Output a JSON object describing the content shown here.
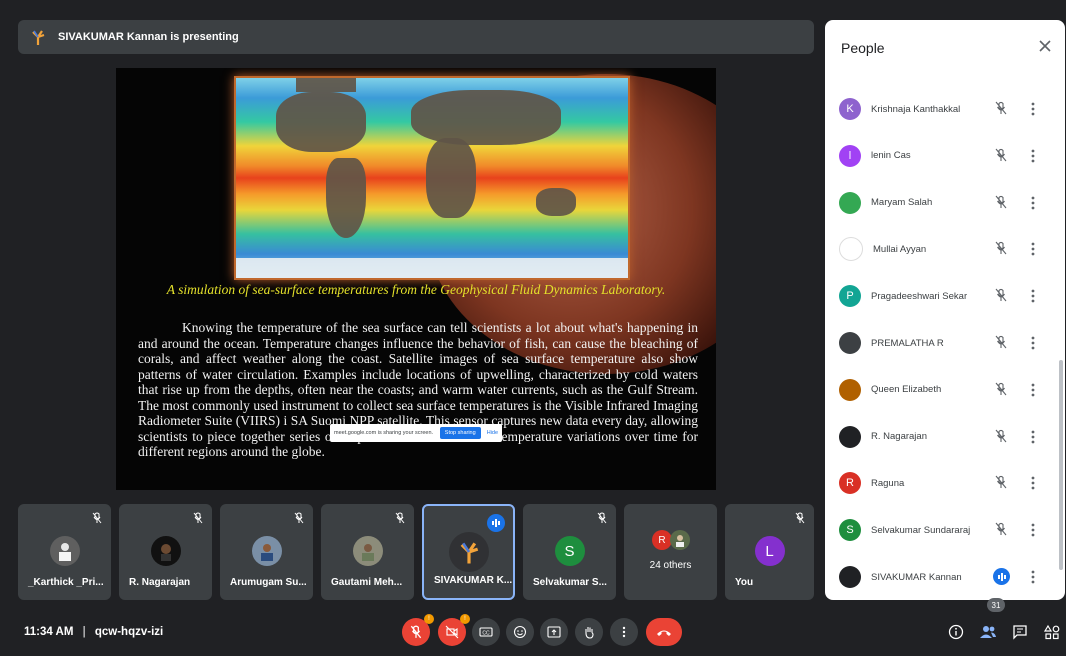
{
  "presenter_banner": {
    "text": "SIVAKUMAR Kannan is presenting"
  },
  "slide": {
    "caption": "A simulation of sea-surface temperatures from the Geophysical Fluid Dynamics Laboratory.",
    "body": "Knowing the temperature of the sea surface can tell scientists a lot about what's happening in and around the ocean. Temperature changes influence the behavior of fish, can cause the bleaching of corals, and affect weather along the coast. Satellite images of sea surface temperature also show patterns of water circulation. Examples include locations of upwelling, characterized by cold waters that rise up from the depths, often near the coasts; and warm water currents, such as the Gulf Stream. The most commonly used instrument to collect sea surface temperatures is the Visible Infrared Imaging Radiometer Suite (VIIRS) i SA Suomi NPP satellite. This sensor captures new data every day, allowing scientists to piece together series of maps that show sea surface temperature variations over time for different regions around the globe."
  },
  "share_notice": {
    "text": "meet.google.com is sharing your screen.",
    "stop_label": "Stop sharing",
    "hide_label": "Hide"
  },
  "tiles": [
    {
      "name": "_Karthick _Pri...",
      "muted": true
    },
    {
      "name": "R. Nagarajan",
      "muted": true
    },
    {
      "name": "Arumugam Su...",
      "muted": true
    },
    {
      "name": "Gautami Meh...",
      "muted": true
    },
    {
      "name": "SIVAKUMAR K...",
      "speaking": true
    },
    {
      "name": "Selvakumar S...",
      "initial": "S",
      "color": "#1e8e3e",
      "muted": true
    },
    {
      "others_label": "24 others",
      "initial": "R",
      "color": "#d93025"
    },
    {
      "name": "You",
      "initial": "L",
      "color": "#8430ce",
      "muted": true
    }
  ],
  "people_panel": {
    "title": "People",
    "participants": [
      {
        "name": "Krishnaja Kanthakkal",
        "initial": "K",
        "color": "#8e63ce"
      },
      {
        "name": "lenin Cas",
        "initial": "l",
        "color": "#a142f4"
      },
      {
        "name": "Maryam Salah",
        "initial": "",
        "color": "#34a853"
      },
      {
        "name": "Mullai Ayyan",
        "initial": "",
        "color": "#ffffff"
      },
      {
        "name": "Pragadeeshwari Sekar",
        "initial": "P",
        "color": "#12a594"
      },
      {
        "name": "PREMALATHA R",
        "initial": "",
        "color": "#3c4043"
      },
      {
        "name": "Queen Elizabeth",
        "initial": "",
        "color": "#b06000"
      },
      {
        "name": "R. Nagarajan",
        "initial": "",
        "color": "#202124"
      },
      {
        "name": "Raguna",
        "initial": "R",
        "color": "#d93025"
      },
      {
        "name": "Selvakumar Sundararaj",
        "initial": "S",
        "color": "#1e8e3e"
      },
      {
        "name": "SIVAKUMAR Kannan",
        "initial": "",
        "color": "#202124"
      }
    ],
    "count": "31"
  },
  "bottom_bar": {
    "time": "11:34 AM",
    "separator": "|",
    "meeting_code": "qcw-hqzv-izi"
  },
  "colors": {
    "accent": "#1a73e8",
    "end_call": "#ea4335",
    "background": "#202124"
  }
}
